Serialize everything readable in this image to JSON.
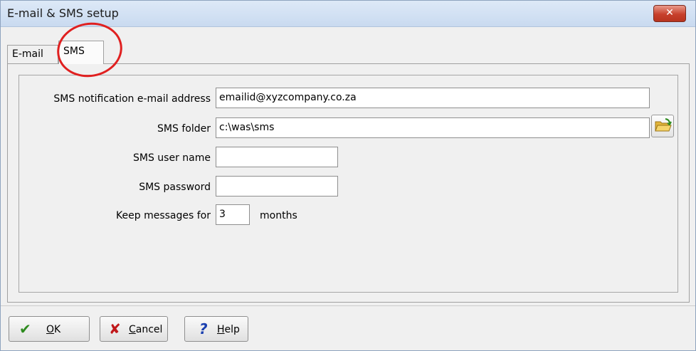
{
  "window": {
    "title": "E-mail & SMS setup",
    "close_label": "✕"
  },
  "tabs": [
    {
      "label": "E-mail"
    },
    {
      "label": "SMS"
    }
  ],
  "form": {
    "sms_email_label": "SMS notification e-mail address",
    "sms_email_value": "emailid@xyzcompany.co.za",
    "sms_folder_label": "SMS folder",
    "sms_folder_value": "c:\\was\\sms",
    "sms_user_label": "SMS user name",
    "sms_user_value": "",
    "sms_password_label": "SMS password",
    "sms_password_value": "",
    "keep_label": "Keep messages for",
    "keep_value": "3",
    "keep_unit": "months"
  },
  "buttons": {
    "ok_underline": "O",
    "ok_rest": "K",
    "cancel_underline": "C",
    "cancel_rest": "ancel",
    "help_underline": "H",
    "help_rest": "elp"
  },
  "icons": {
    "ok": "checkmark-icon",
    "cancel": "x-icon",
    "help": "question-icon",
    "folder": "open-folder-icon"
  },
  "colors": {
    "accent_red": "#e02020",
    "check_green": "#2e8b1f",
    "cancel_red": "#c0171a",
    "help_blue": "#1a3fb0"
  }
}
